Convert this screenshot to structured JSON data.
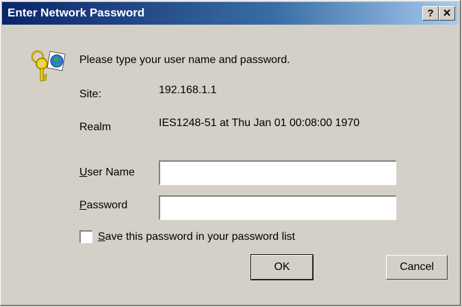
{
  "window": {
    "title": "Enter Network Password",
    "help_label": "?",
    "close_label": "✕"
  },
  "prompt": "Please type your user name and password.",
  "site": {
    "label": "Site:",
    "value": "192.168.1.1"
  },
  "realm": {
    "label": "Realm",
    "value": "IES1248-51 at Thu Jan 01 00:08:00 1970"
  },
  "username": {
    "label_first": "U",
    "label_rest": "ser Name",
    "value": ""
  },
  "password": {
    "label_first": "P",
    "label_rest": "assword",
    "value": ""
  },
  "save": {
    "label_first": "S",
    "label_rest": "ave this password in your password list",
    "checked": false
  },
  "buttons": {
    "ok": "OK",
    "cancel": "Cancel"
  },
  "icon": "keys-icon"
}
